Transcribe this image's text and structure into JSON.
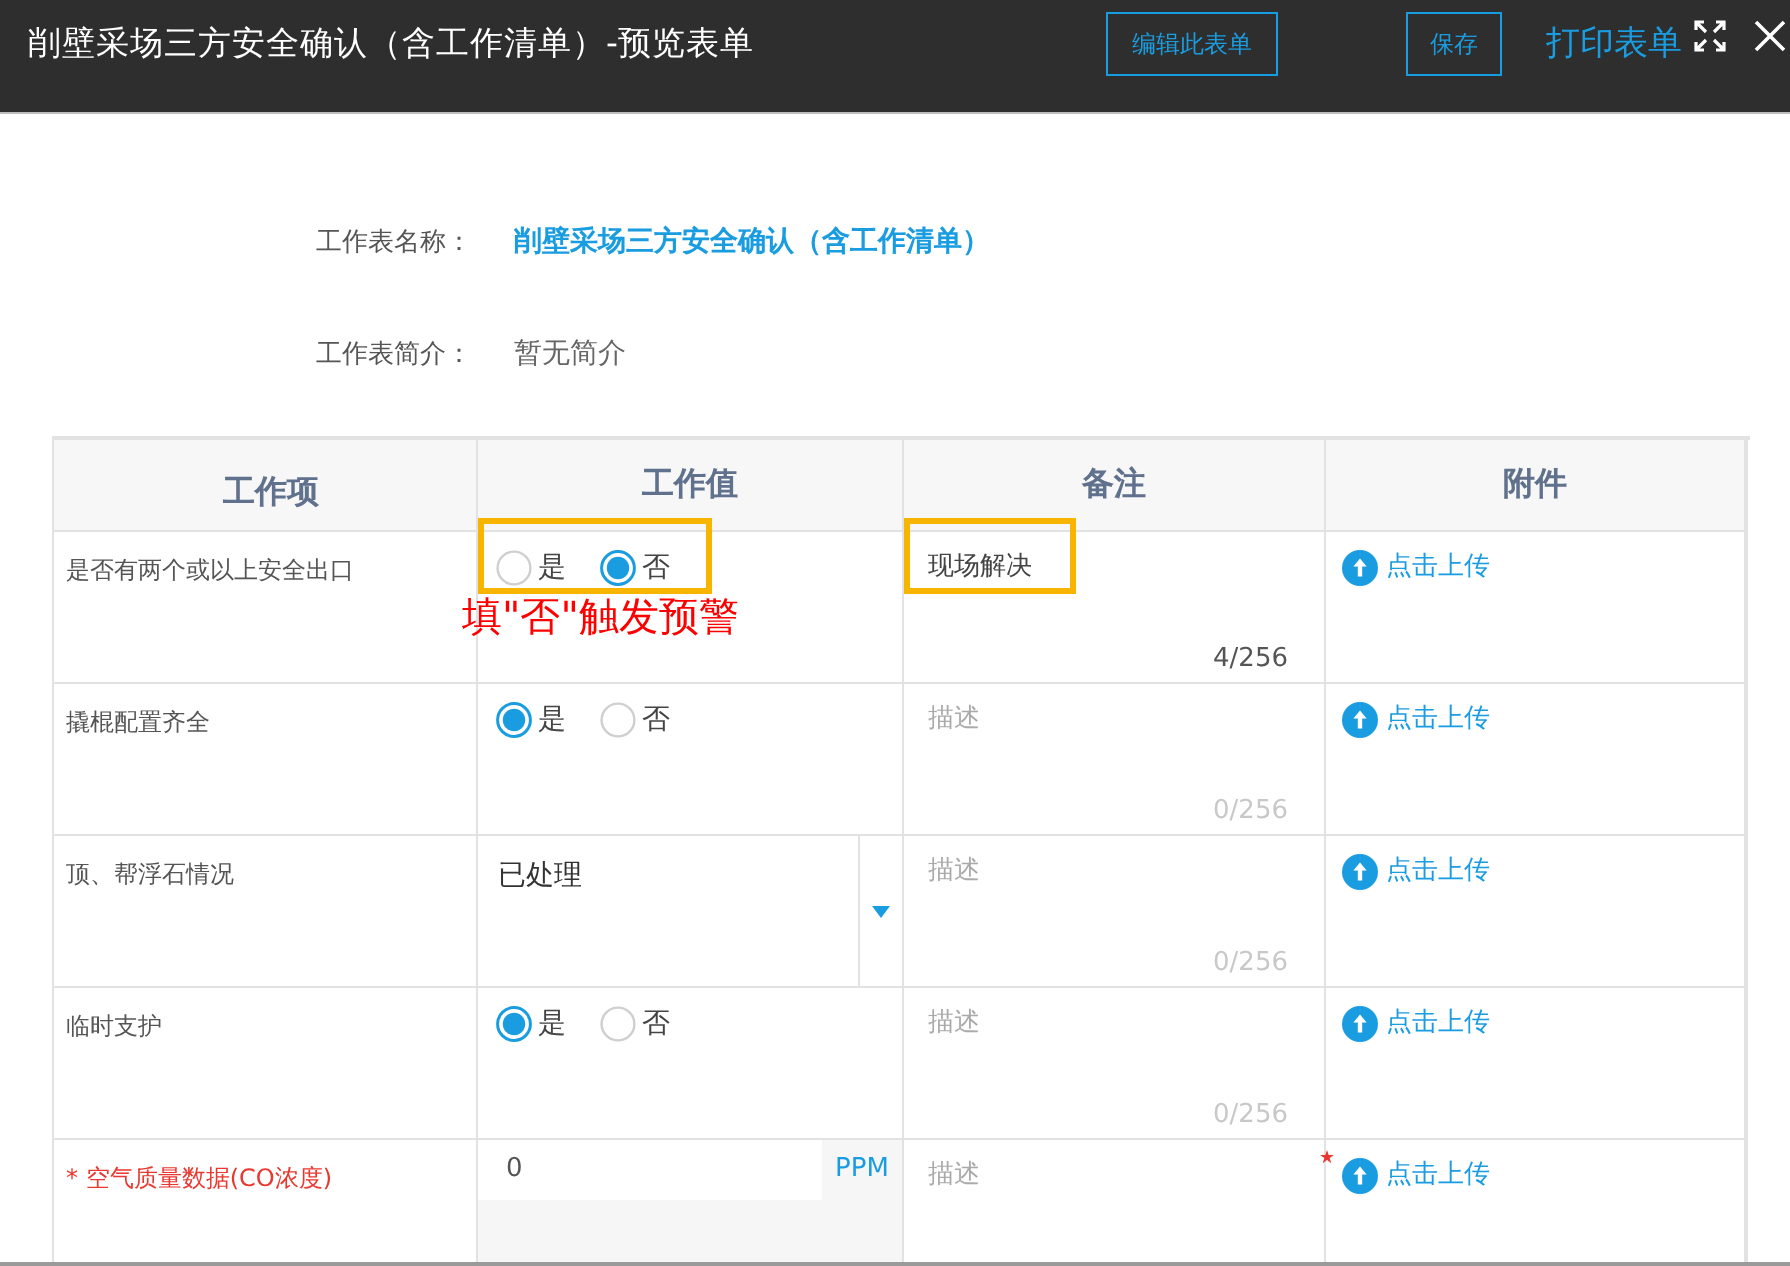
{
  "window": {
    "title": "削壁采场三方安全确认（含工作清单）-预览表单",
    "buttons": [
      {
        "label": "编辑此表单",
        "kind": "outline"
      },
      {
        "label": "保存",
        "kind": "outline"
      },
      {
        "label": "打印表单",
        "kind": "link"
      }
    ]
  },
  "info": [
    {
      "label": "工作表名称：",
      "value": "削壁采场三方安全确认（含工作清单）",
      "kind": "title"
    },
    {
      "label": "工作表简介：",
      "value": "暂无简介",
      "kind": "text"
    }
  ],
  "table": {
    "columns": [
      "工作项",
      "工作值",
      "备注",
      "附件"
    ],
    "rows": [
      {
        "item": "是否有两个或以上安全出口",
        "required": false,
        "value": {
          "kind": "radio",
          "highlighted": true,
          "options": [
            {
              "label": "是",
              "selected": false
            },
            {
              "label": "否",
              "selected": true
            }
          ]
        },
        "callout": "填\"否\"触发预警",
        "note": {
          "value": "现场解决",
          "counter": "4/256",
          "highlighted": true
        },
        "attachment": "点击上传"
      },
      {
        "item": "撬棍配置齐全",
        "required": false,
        "value": {
          "kind": "radio",
          "highlighted": false,
          "options": [
            {
              "label": "是",
              "selected": true
            },
            {
              "label": "否",
              "selected": false
            }
          ]
        },
        "note": {
          "placeholder": "描述",
          "counter": "0/256",
          "highlighted": false
        },
        "attachment": "点击上传"
      },
      {
        "item": "顶、帮浮石情况",
        "required": false,
        "value": {
          "kind": "select",
          "highlighted": false,
          "value": "已处理"
        },
        "note": {
          "placeholder": "描述",
          "counter": "0/256",
          "highlighted": false
        },
        "attachment": "点击上传"
      },
      {
        "item": "临时支护",
        "required": false,
        "value": {
          "kind": "radio",
          "highlighted": false,
          "options": [
            {
              "label": "是",
              "selected": true
            },
            {
              "label": "否",
              "selected": false
            }
          ]
        },
        "note": {
          "placeholder": "描述",
          "counter": "0/256",
          "highlighted": false
        },
        "attachment": "点击上传"
      },
      {
        "item": "* 空气质量数据(CO浓度)",
        "required": true,
        "value": {
          "kind": "number",
          "highlighted": false,
          "value": "0",
          "unit": "PPM"
        },
        "note": {
          "placeholder": "描述",
          "highlighted": false
        },
        "attachment": "点击上传"
      }
    ]
  }
}
